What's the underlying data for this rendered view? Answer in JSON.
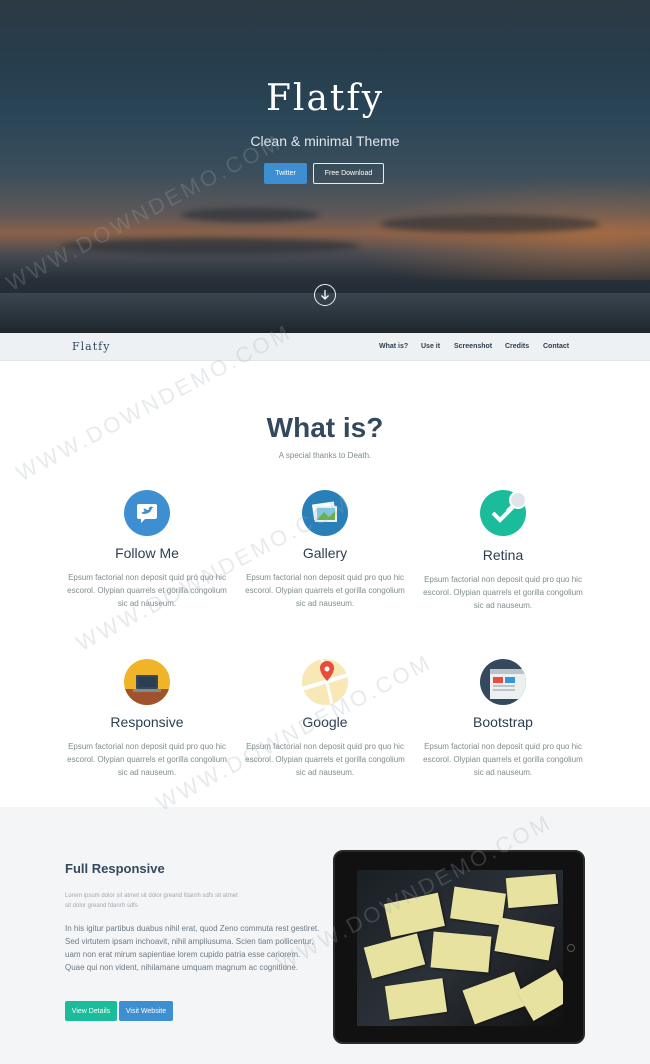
{
  "hero": {
    "title": "Flatfy",
    "subtitle": "Clean & minimal Theme",
    "twitter_button": "Twitter",
    "download_button": "Free Download"
  },
  "navbar": {
    "brand": "Flatfy",
    "items": [
      "What is?",
      "Use it",
      "Screenshot",
      "Credits",
      "Contact"
    ]
  },
  "what_is": {
    "title": "What is?",
    "subtitle": "A special thanks to Death.",
    "features": [
      {
        "title": "Follow Me",
        "icon": "twitter-icon",
        "desc": "Epsum factorial non deposit quid pro quo hic escorol. Olypian quarrels et gorilla congolium sic ad nauseum."
      },
      {
        "title": "Gallery",
        "icon": "gallery-icon",
        "desc": "Epsum factorial non deposit quid pro quo hic escorol. Olypian quarrels et gorilla congolium sic ad nauseum."
      },
      {
        "title": "Retina",
        "icon": "retina-check-icon",
        "desc": "Epsum factorial non deposit quid pro quo hic escorol. Olypian quarrels et gorilla congolium sic ad nauseum."
      },
      {
        "title": "Responsive",
        "icon": "responsive-laptop-icon",
        "desc": "Epsum factorial non deposit quid pro quo hic escorol. Olypian quarrels et gorilla congolium sic ad nauseum."
      },
      {
        "title": "Google",
        "icon": "map-pin-icon",
        "desc": "Epsum factorial non deposit quid pro quo hic escorol. Olypian quarrels et gorilla congolium sic ad nauseum."
      },
      {
        "title": "Bootstrap",
        "icon": "browser-icon",
        "desc": "Epsum factorial non deposit quid pro quo hic escorol. Olypian quarrels et gorilla congolium sic ad nauseum."
      }
    ]
  },
  "full_responsive": {
    "title": "Full Responsive",
    "small_text": "Lorem ipsum dolor sit atmet sit dolor greand fdanrh sdfs sit atmet sit dolor greand fdanrh sdfs",
    "body": "In his igitur partibus duabus nihil erat, quod Zeno commuta rest gestiret. Sed virtutem ipsam inchoavit, nihil ampliusuma. Scien tiam pollicentur, uam non erat mirum sapientiae lorem cupido patria esse cariorem. Quae qui non vident, nihilamane umquam magnum ac cognitione.",
    "details_button": "View Details",
    "website_button": "Visit Website"
  },
  "watermark": "WWW.DOWNDEMO.COM",
  "colors": {
    "accent_blue": "#3d8fd1",
    "accent_green": "#1abc9c",
    "heading": "#34495e"
  }
}
